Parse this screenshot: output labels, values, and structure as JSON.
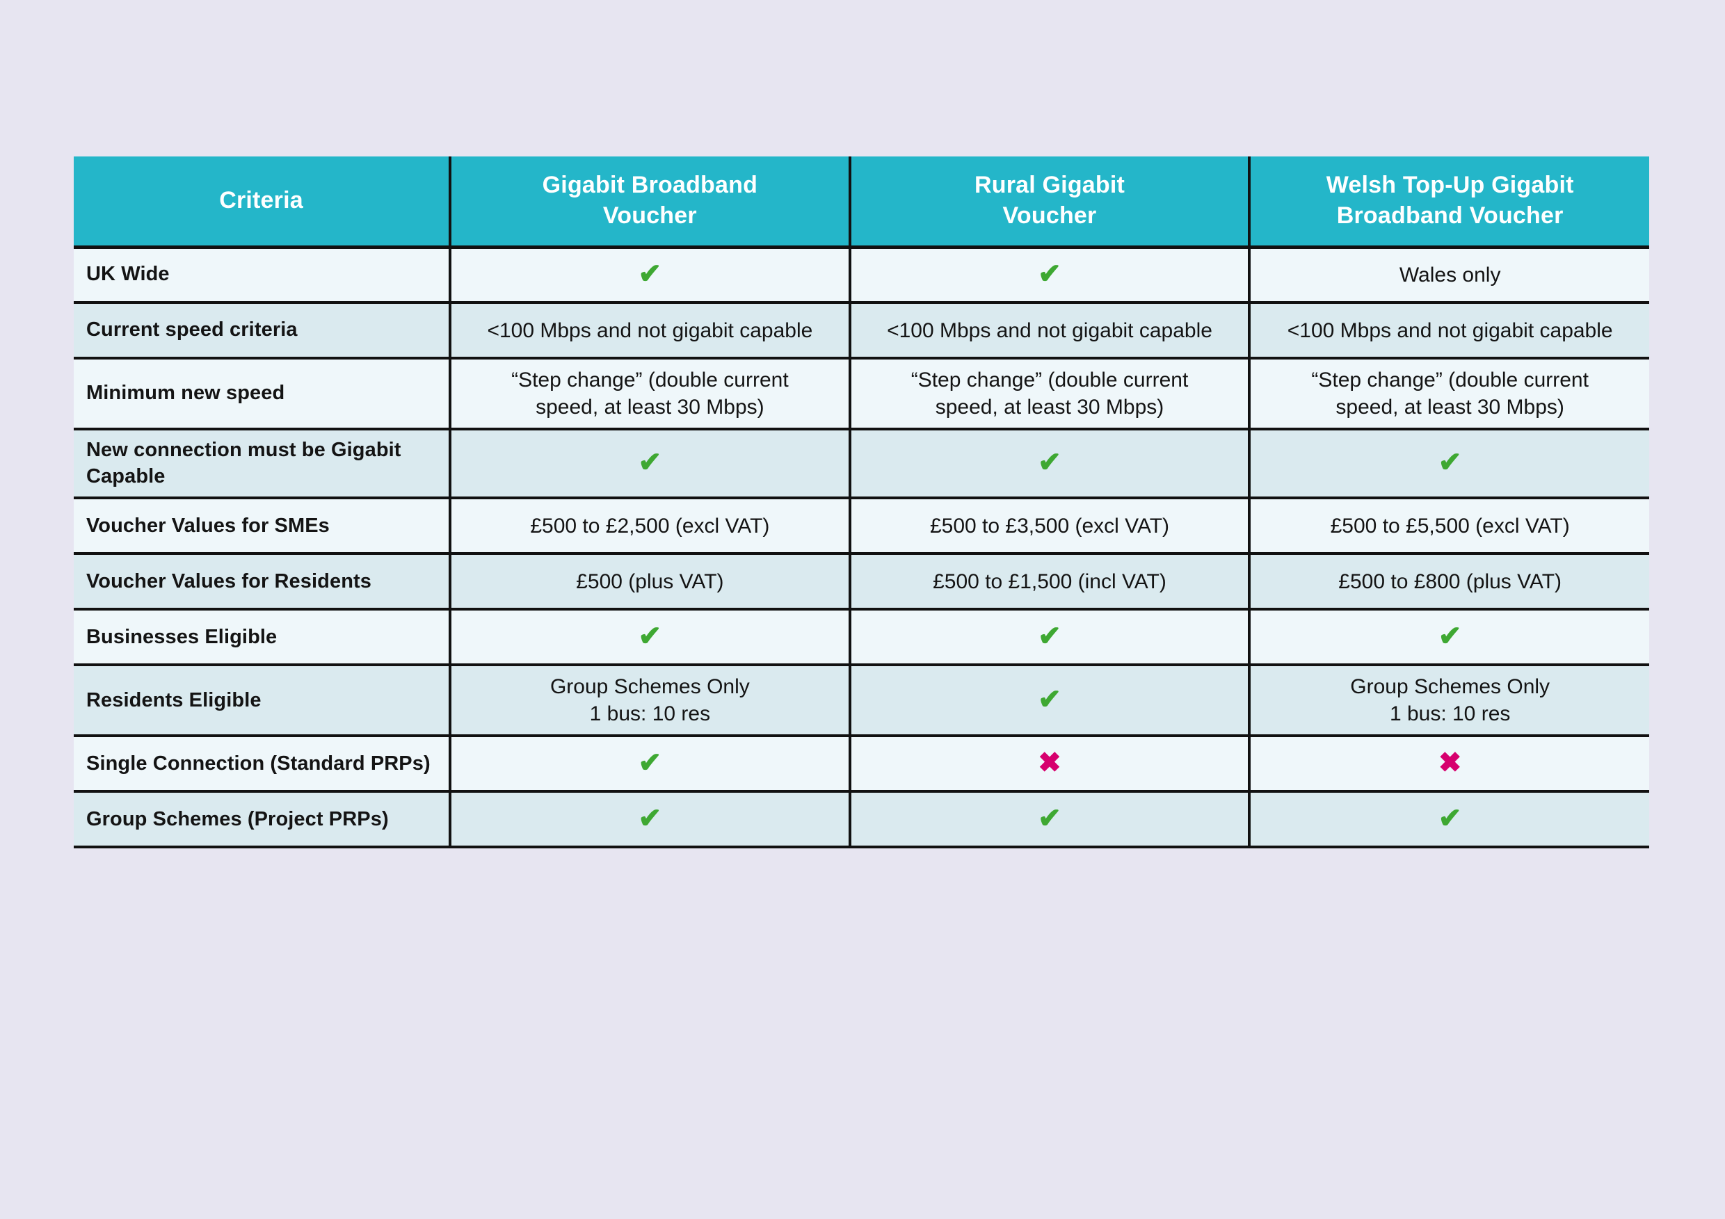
{
  "colors": {
    "page_background": "#e7e5f1",
    "header_teal": "#24b6c9",
    "row_light": "#eff7fa",
    "row_dark": "#daeaef",
    "tick_green": "#3ea832",
    "cross_magenta": "#d6006e",
    "border_black": "#111111",
    "header_text": "#ffffff"
  },
  "table": {
    "headers": [
      {
        "lines": [
          "Criteria"
        ]
      },
      {
        "lines": [
          "Gigabit Broadband",
          "Voucher"
        ]
      },
      {
        "lines": [
          "Rural Gigabit",
          "Voucher"
        ]
      },
      {
        "lines": [
          "Welsh Top-Up Gigabit",
          "Broadband Voucher"
        ]
      }
    ],
    "rows": [
      {
        "criteria": "UK Wide",
        "cells": [
          {
            "type": "tick",
            "text": "✔"
          },
          {
            "type": "tick",
            "text": "✔"
          },
          {
            "type": "text",
            "text": "Wales only"
          }
        ]
      },
      {
        "criteria": "Current speed criteria",
        "cells": [
          {
            "type": "text",
            "text": "<100 Mbps and not gigabit capable"
          },
          {
            "type": "text",
            "text": "<100 Mbps and not gigabit capable"
          },
          {
            "type": "text",
            "text": "<100 Mbps and not gigabit capable"
          }
        ]
      },
      {
        "criteria": "Minimum new speed",
        "cells": [
          {
            "type": "text",
            "text": "“Step change” (double current\nspeed, at least 30 Mbps)"
          },
          {
            "type": "text",
            "text": "“Step change” (double current\nspeed, at least 30 Mbps)"
          },
          {
            "type": "text",
            "text": "“Step change” (double current\nspeed, at least 30 Mbps)"
          }
        ]
      },
      {
        "criteria": "New connection must be  Gigabit Capable",
        "cells": [
          {
            "type": "tick",
            "text": "✔"
          },
          {
            "type": "tick",
            "text": "✔"
          },
          {
            "type": "tick",
            "text": "✔"
          }
        ]
      },
      {
        "criteria": "Voucher Values for SMEs",
        "cells": [
          {
            "type": "text",
            "text": "£500 to £2,500 (excl VAT)"
          },
          {
            "type": "text",
            "text": "£500 to £3,500 (excl VAT)"
          },
          {
            "type": "text",
            "text": "£500 to £5,500  (excl VAT)"
          }
        ]
      },
      {
        "criteria": "Voucher Values for Residents",
        "cells": [
          {
            "type": "text",
            "text": "£500 (plus VAT)"
          },
          {
            "type": "text",
            "text": "£500 to £1,500 (incl VAT)"
          },
          {
            "type": "text",
            "text": "£500 to £800 (plus VAT)"
          }
        ]
      },
      {
        "criteria": "Businesses Eligible",
        "cells": [
          {
            "type": "tick",
            "text": "✔"
          },
          {
            "type": "tick",
            "text": "✔"
          },
          {
            "type": "tick",
            "text": "✔"
          }
        ]
      },
      {
        "criteria": "Residents Eligible",
        "cells": [
          {
            "type": "text",
            "text": "Group Schemes Only\n1 bus: 10 res"
          },
          {
            "type": "tick",
            "text": "✔"
          },
          {
            "type": "text",
            "text": "Group Schemes Only\n1 bus: 10 res"
          }
        ]
      },
      {
        "criteria": "Single Connection (Standard PRPs)",
        "cells": [
          {
            "type": "tick",
            "text": "✔"
          },
          {
            "type": "cross",
            "text": "✖"
          },
          {
            "type": "cross",
            "text": "✖"
          }
        ]
      },
      {
        "criteria": "Group Schemes (Project PRPs)",
        "cells": [
          {
            "type": "tick",
            "text": "✔"
          },
          {
            "type": "tick",
            "text": "✔"
          },
          {
            "type": "tick",
            "text": "✔"
          }
        ]
      }
    ]
  }
}
